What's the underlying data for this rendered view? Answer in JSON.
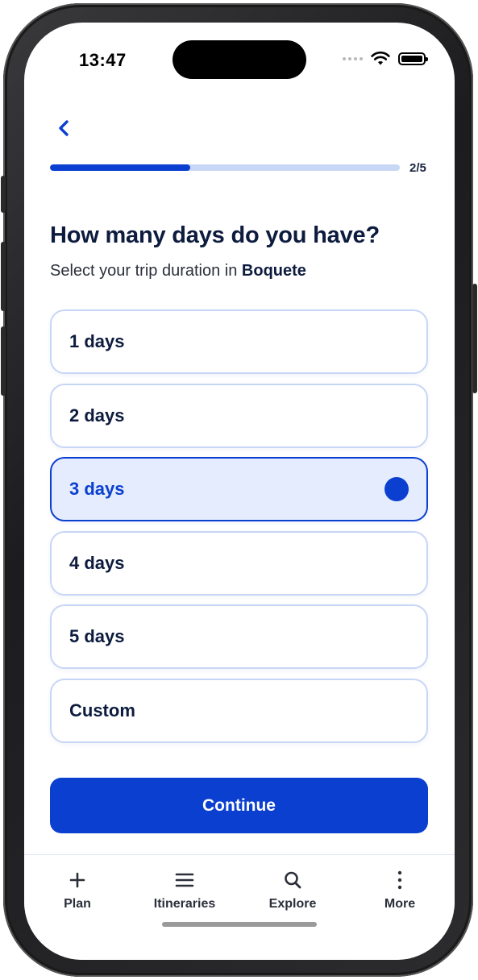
{
  "status": {
    "time": "13:47"
  },
  "header": {
    "progress_label": "2/5",
    "progress_fraction": 0.4
  },
  "main": {
    "title": "How many days do you have?",
    "subtitle_prefix": "Select your trip duration in ",
    "subtitle_place": "Boquete"
  },
  "options": [
    {
      "label": "1 days",
      "selected": false
    },
    {
      "label": "2 days",
      "selected": false
    },
    {
      "label": "3 days",
      "selected": true
    },
    {
      "label": "4 days",
      "selected": false
    },
    {
      "label": "5 days",
      "selected": false
    },
    {
      "label": "Custom",
      "selected": false
    }
  ],
  "continue_label": "Continue",
  "tabbar": {
    "items": [
      {
        "label": "Plan",
        "icon": "plus-icon"
      },
      {
        "label": "Itineraries",
        "icon": "menu-icon"
      },
      {
        "label": "Explore",
        "icon": "search-icon"
      },
      {
        "label": "More",
        "icon": "more-vertical-icon"
      }
    ]
  },
  "colors": {
    "accent": "#0a3fd0",
    "selected_bg": "#e4ecfd",
    "border": "#c8d6f6",
    "text": "#0d1b3e"
  }
}
